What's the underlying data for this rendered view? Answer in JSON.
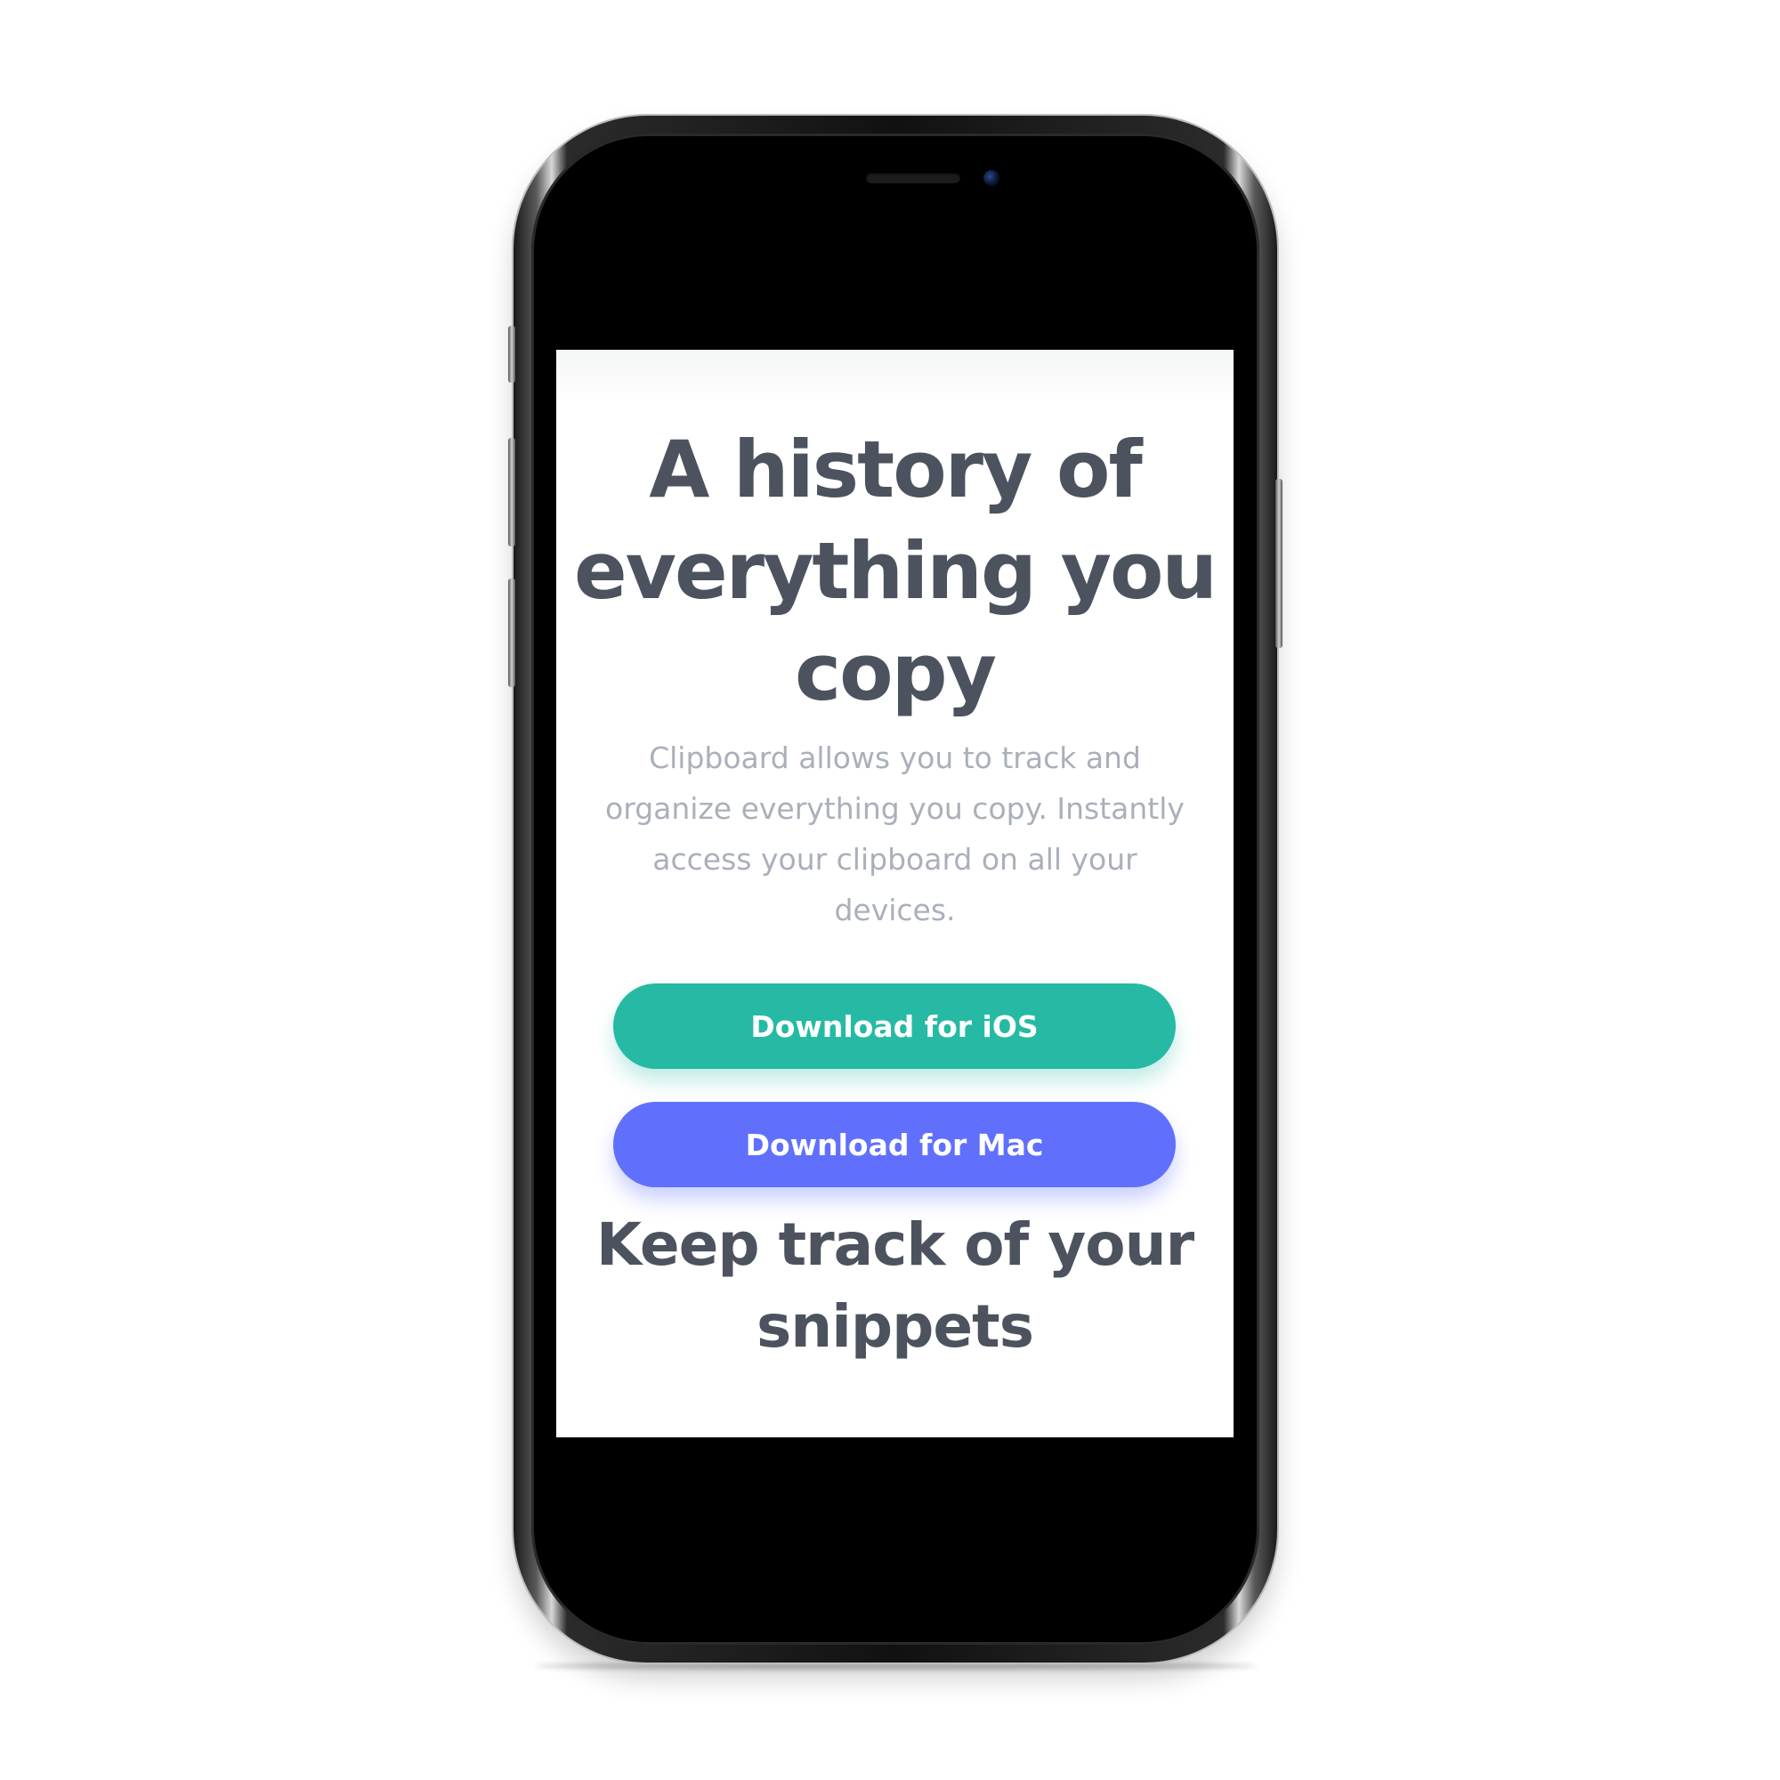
{
  "hero": {
    "title_lines": [
      "A history of",
      "everything you",
      "copy"
    ],
    "description_lines": [
      "Clipboard allows you to track and",
      "organize everything you copy. Instantly",
      "access your clipboard on all your",
      "devices."
    ]
  },
  "buttons": {
    "ios_label": "Download for iOS",
    "mac_label": "Download for Mac"
  },
  "section": {
    "title_lines": [
      "Keep track of your",
      "snippets"
    ]
  },
  "colors": {
    "heading": "#4c535e",
    "body_text": "#aab0ba",
    "ios_button": "#26baa4",
    "mac_button": "#6070fd",
    "device_frame": "#000000"
  }
}
